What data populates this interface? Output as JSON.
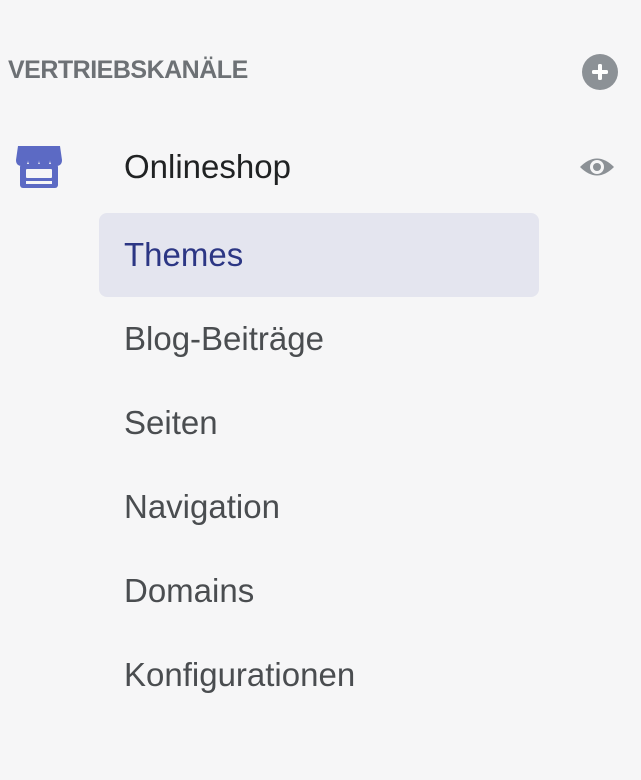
{
  "sales_channels": {
    "title": "VERTRIEBSKANÄLE",
    "add_icon": "plus-circle-icon"
  },
  "channel": {
    "label": "Onlineshop",
    "icon": "store-icon",
    "view_icon": "eye-icon",
    "accent_color": "#5c6ac4"
  },
  "subnav": {
    "items": [
      {
        "label": "Themes",
        "active": true
      },
      {
        "label": "Blog-Beiträge",
        "active": false
      },
      {
        "label": "Seiten",
        "active": false
      },
      {
        "label": "Navigation",
        "active": false
      },
      {
        "label": "Domains",
        "active": false
      },
      {
        "label": "Konfigurationen",
        "active": false
      }
    ]
  }
}
